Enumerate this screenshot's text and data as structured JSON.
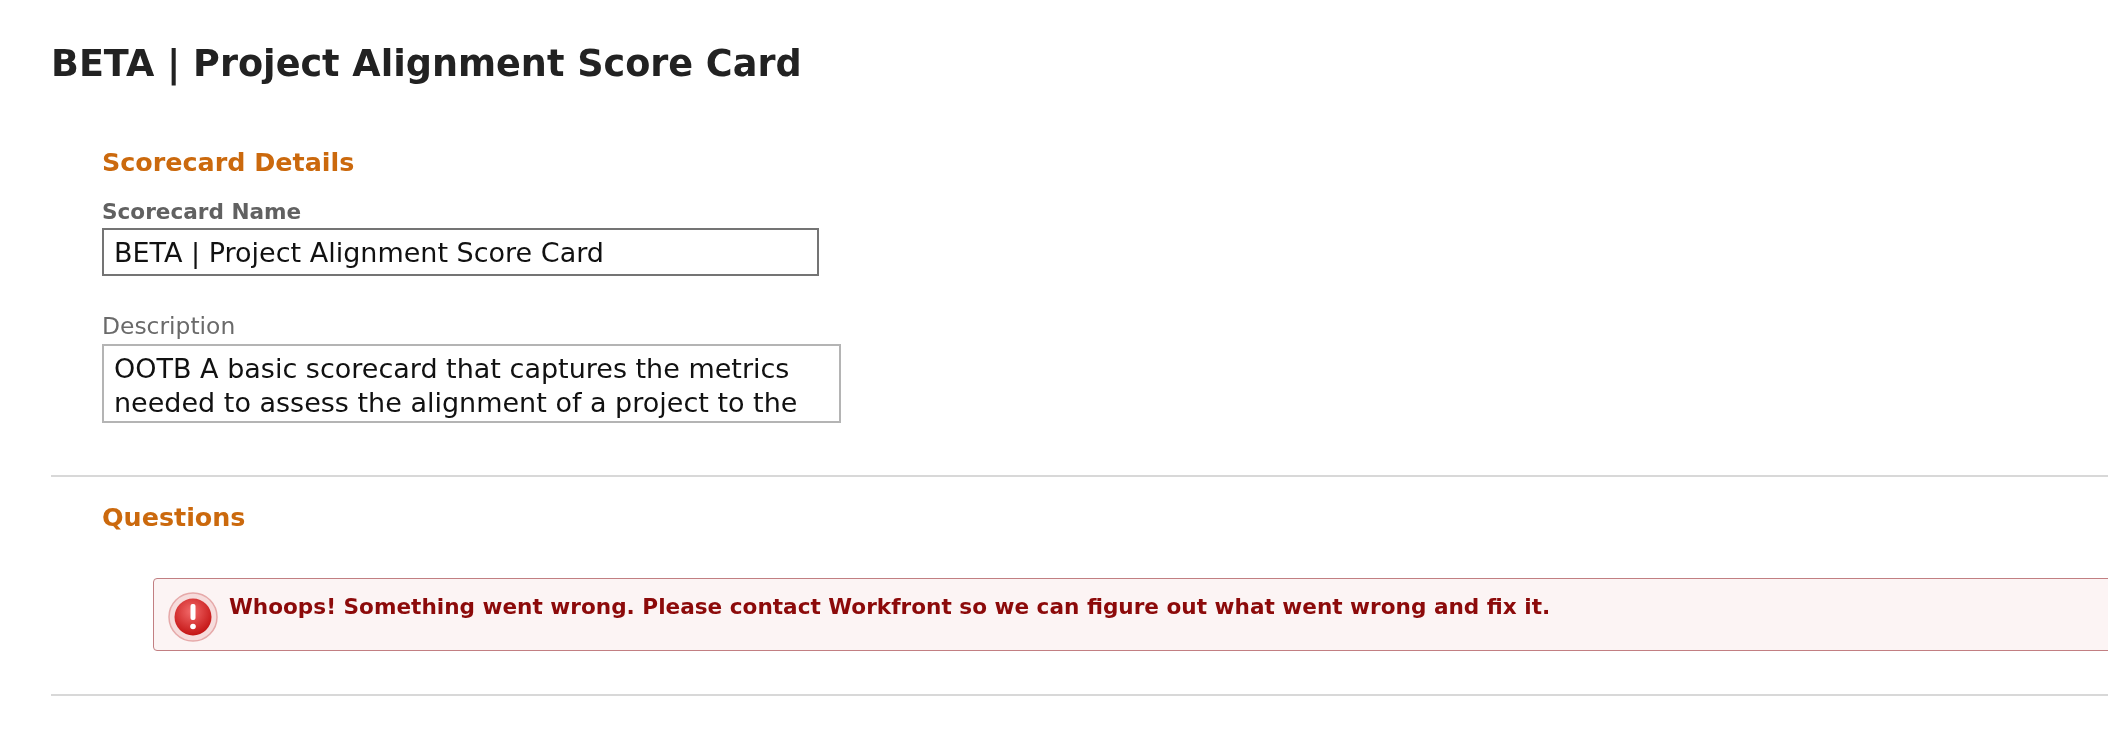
{
  "page": {
    "title": "BETA | Project Alignment Score Card"
  },
  "scorecard_details": {
    "heading": "Scorecard Details",
    "fields": [
      {
        "kind": "input",
        "label": "Scorecard Name",
        "required": true,
        "value": "BETA | Project Alignment Score Card"
      },
      {
        "kind": "textarea",
        "label": "Description",
        "required": false,
        "value": "OOTB A basic scorecard that captures the metrics needed to assess the alignment of a project to the"
      }
    ]
  },
  "questions": {
    "heading": "Questions",
    "error": {
      "message": "Whoops! Something went wrong. Please contact Workfront so we can figure out what went wrong and fix it."
    }
  }
}
